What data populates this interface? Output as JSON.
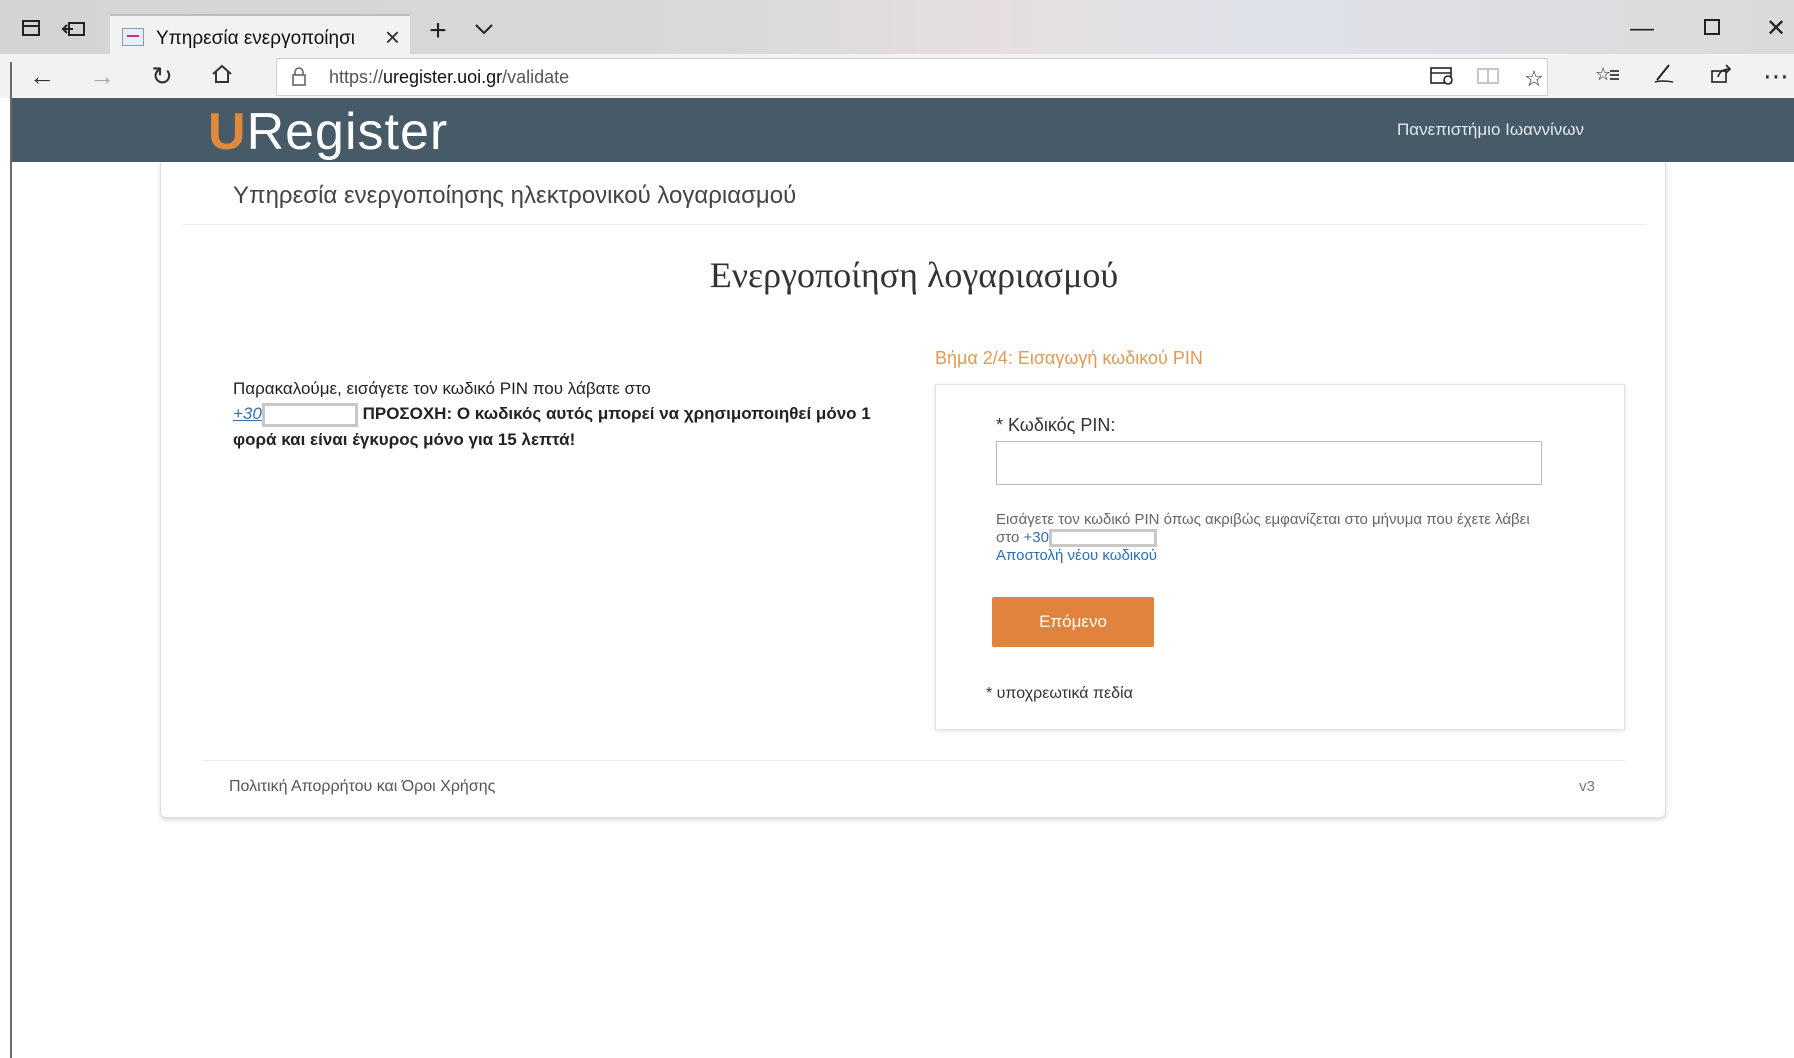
{
  "browser": {
    "tab_title": "Υπηρεσία ενεργοποίησι",
    "url_prefix": "https://",
    "url_domain": "uregister.uoi.gr",
    "url_path": "/validate",
    "icons": {
      "tab_manager": "tab-set-aside-icon",
      "tab_preview": "tab-preview-icon",
      "new_tab": "plus-icon",
      "tab_list": "chevron-down-icon",
      "minimize": "minimize-icon",
      "maximize": "maximize-icon",
      "close": "close-icon",
      "back": "arrow-left-icon",
      "forward": "arrow-right-icon",
      "refresh": "refresh-icon",
      "home": "home-icon",
      "lock": "lock-icon",
      "reading_view": "reading-view-icon",
      "book": "book-icon",
      "favorite": "star-icon",
      "favorites_list": "favorites-list-icon",
      "pen": "pen-icon",
      "share": "share-icon",
      "more": "more-icon"
    }
  },
  "site": {
    "logo_u": "U",
    "logo_rest": "Register",
    "university": "Πανεπιστήμιο Ιωαννίνων",
    "accent_color": "#e1833d",
    "header_color": "#475a67"
  },
  "page": {
    "service_title": "Υπηρεσία ενεργοποίησης ηλεκτρονικού λογαριασμού",
    "main_title": "Ενεργοποίηση λογαριασμού",
    "instructions_text": "Παρακαλούμε, εισάγετε τον κωδικό PIN που λάβατε στο",
    "phone_prefix": "+30",
    "warning_text": "ΠΡΟΣΟΧΗ: Ο κωδικός αυτός μπορεί να χρησιμοποιηθεί μόνο 1 φορά και είναι έγκυρος μόνο για 15 λεπτά!",
    "step_label": "Βήμα 2/4: Εισαγωγή κωδικού PIN",
    "pin_label": "* Κωδικός PIN:",
    "pin_value": "",
    "help_text": "Εισάγετε τον κωδικό PIN όπως ακριβώς εμφανίζεται στο μήνυμα που έχετε λάβει στο",
    "help_phone_prefix": "+30",
    "resend_link": "Αποστολή νέου κωδικού",
    "next_button": "Επόμενο",
    "required_note": "* υποχρεωτικά πεδία",
    "footer_link": "Πολιτική Απορρήτου και Όροι Χρήσης",
    "version": "v3"
  }
}
